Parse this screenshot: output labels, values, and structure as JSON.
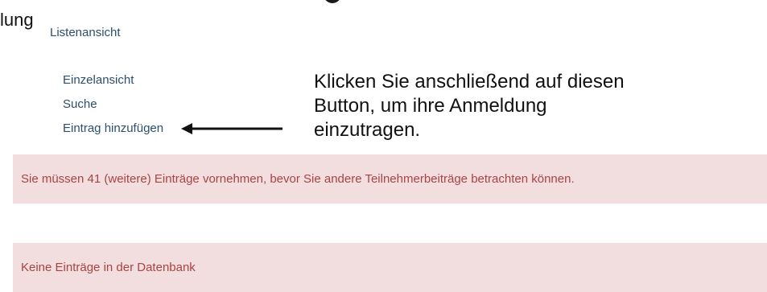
{
  "heading": {
    "fragment": "lung"
  },
  "nav": {
    "list_view": "Listenansicht",
    "single_view": "Einzelansicht",
    "search": "Suche",
    "add_entry": "Eintrag hinzufügen"
  },
  "annotation": {
    "line1": "Klicken Sie anschließend auf diesen",
    "line2": "Button, um ihre Anmeldung",
    "line3": "einzutragen."
  },
  "alerts": {
    "entries_required": "Sie müssen 41 (weitere) Einträge vornehmen, bevor Sie andere Teilnehmerbeiträge betrachten können.",
    "no_entries": "Keine Einträge in der Datenbank"
  },
  "colors": {
    "link": "#2c4f6a",
    "alert_background": "#f2dede",
    "alert_text": "#a94442"
  }
}
